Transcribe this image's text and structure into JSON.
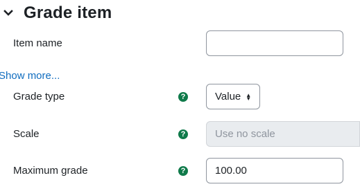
{
  "section": {
    "title": "Grade item",
    "chevron_icon": "chevron-down-icon"
  },
  "fields": {
    "item_name": {
      "label": "Item name",
      "value": ""
    },
    "show_more": "Show more...",
    "grade_type": {
      "label": "Grade type",
      "value": "Value",
      "help_icon": "question-circle-icon"
    },
    "scale": {
      "label": "Scale",
      "value": "Use no scale",
      "help_icon": "question-circle-icon"
    },
    "maximum_grade": {
      "label": "Maximum grade",
      "value": "100.00",
      "help_icon": "question-circle-icon"
    }
  },
  "colors": {
    "link": "#0f6cbf",
    "help_icon": "#0f7a4a",
    "disabled_bg": "#e9ecef"
  }
}
